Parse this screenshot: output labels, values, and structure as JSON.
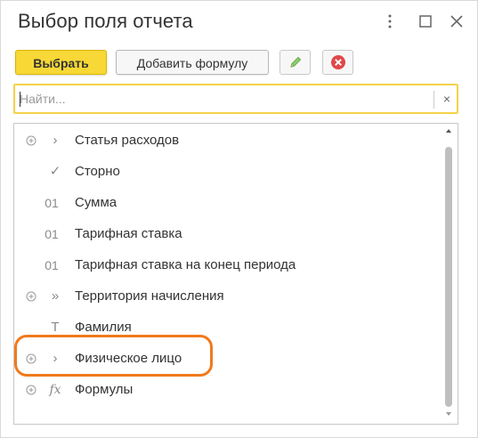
{
  "window": {
    "title": "Выбор поля отчета"
  },
  "toolbar": {
    "select_label": "Выбрать",
    "add_formula_label": "Добавить формулу"
  },
  "search": {
    "placeholder": "Найти...",
    "value": "",
    "clear_glyph": "×"
  },
  "list": {
    "items": [
      {
        "label": "Статья расходов",
        "icon": "chevron-right-icon",
        "icon_glyph": "›",
        "expandable": true
      },
      {
        "label": "Сторно",
        "icon": "checkmark-icon",
        "icon_glyph": "✓",
        "expandable": false
      },
      {
        "label": "Сумма",
        "icon": "number-icon",
        "icon_glyph": "01",
        "expandable": false
      },
      {
        "label": "Тарифная ставка",
        "icon": "number-icon",
        "icon_glyph": "01",
        "expandable": false
      },
      {
        "label": "Тарифная ставка на конец периода",
        "icon": "number-icon",
        "icon_glyph": "01",
        "expandable": false
      },
      {
        "label": "Территория начисления",
        "icon": "double-chevron-right-icon",
        "icon_glyph": "»",
        "expandable": true
      },
      {
        "label": "Фамилия",
        "icon": "text-type-icon",
        "icon_glyph": "T",
        "expandable": false
      },
      {
        "label": "Физическое лицо",
        "icon": "chevron-right-icon",
        "icon_glyph": "›",
        "expandable": true
      },
      {
        "label": "Формулы",
        "icon": "formula-icon",
        "icon_glyph": "fx",
        "expandable": true
      }
    ]
  },
  "colors": {
    "accent_button": "#f7d836",
    "search_border": "#f5d24a",
    "highlight": "#f07a1c",
    "delete_icon": "#e0484a",
    "edit_icon": "#7cbf5a"
  }
}
